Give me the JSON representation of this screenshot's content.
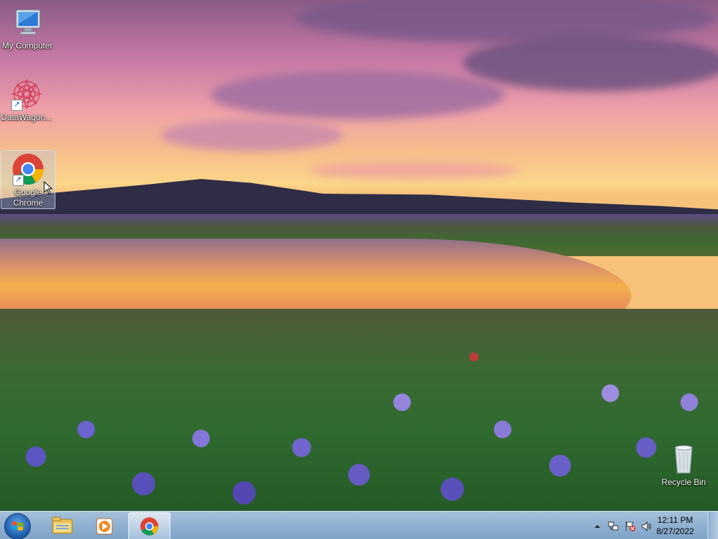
{
  "desktop": {
    "icons": [
      {
        "label": "My Computer",
        "icon": "computer-icon"
      },
      {
        "label": "DataWagon...",
        "icon": "datawagon-icon"
      },
      {
        "label_line1": "Google",
        "label_line2": "Chrome",
        "icon": "chrome-icon",
        "selected": true
      },
      {
        "label": "Recycle Bin",
        "icon": "recycle-bin-icon"
      }
    ]
  },
  "taskbar": {
    "start_icon": "windows-start-icon",
    "pinned": [
      {
        "icon": "file-explorer-icon"
      },
      {
        "icon": "media-player-icon"
      },
      {
        "icon": "chrome-icon",
        "active": true
      }
    ],
    "tray": {
      "icons": [
        "show-hidden-icons-icon",
        "network-icon",
        "action-center-icon",
        "volume-icon"
      ]
    },
    "clock": {
      "time": "12:11 PM",
      "date": "8/27/2022"
    }
  }
}
